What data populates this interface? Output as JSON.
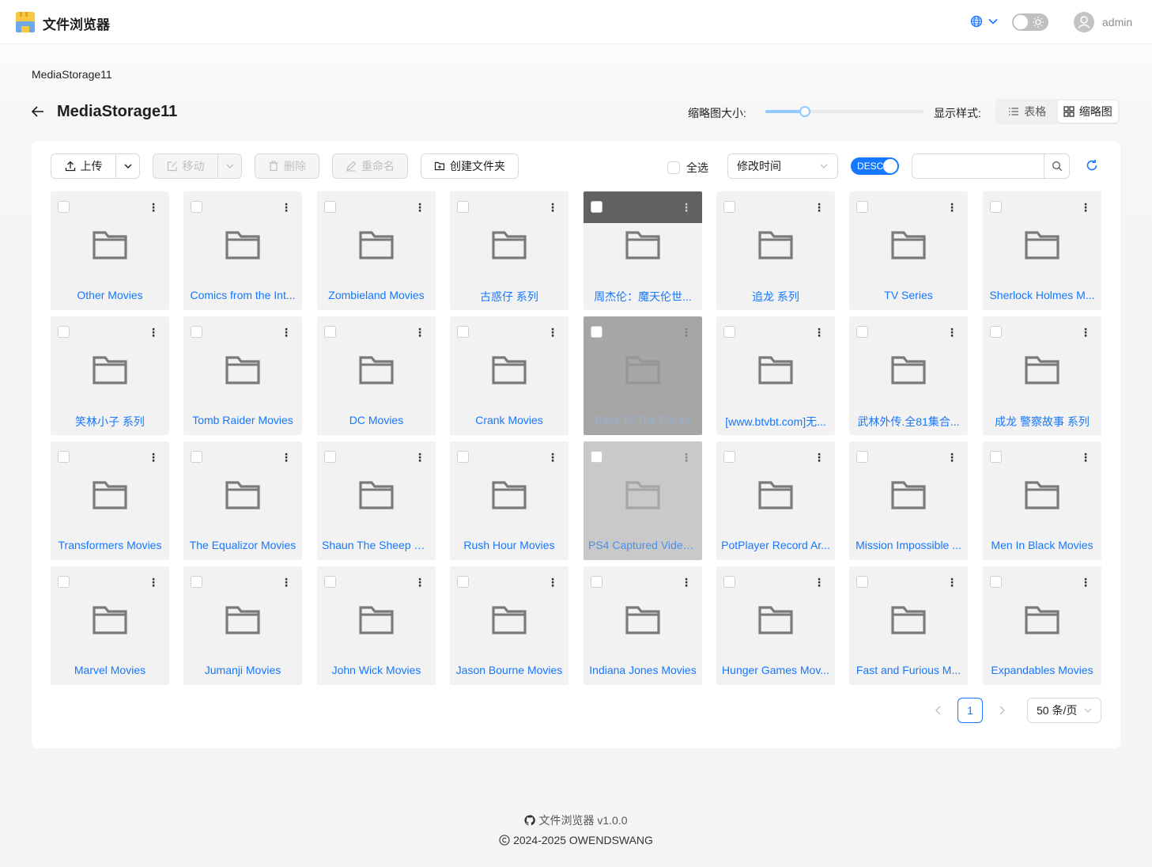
{
  "header": {
    "app_title": "文件浏览器",
    "username": "admin",
    "theme": "light"
  },
  "breadcrumb": "MediaStorage11",
  "page_title": "MediaStorage11",
  "view_controls": {
    "thumb_size_label": "缩略图大小:",
    "thumb_size_value": 0.25,
    "display_label": "显示样式:",
    "modes": [
      {
        "label": "表格",
        "icon": "list-icon",
        "active": false
      },
      {
        "label": "缩略图",
        "icon": "grid-icon",
        "active": true
      }
    ]
  },
  "toolbar": {
    "upload_label": "上传",
    "move_label": "移动",
    "delete_label": "删除",
    "rename_label": "重命名",
    "create_folder_label": "创建文件夹",
    "select_all_label": "全选",
    "sort_value": "修改时间",
    "order_label": "DESC",
    "search_placeholder": ""
  },
  "items": [
    {
      "name": "Other Movies",
      "state": "normal"
    },
    {
      "name": "Comics from the Int...",
      "state": "normal"
    },
    {
      "name": "Zombieland Movies",
      "state": "normal"
    },
    {
      "name": "古惑仔 系列",
      "state": "normal"
    },
    {
      "name": "周杰伦：魔天伦世...",
      "state": "hover"
    },
    {
      "name": "追龙 系列",
      "state": "normal"
    },
    {
      "name": "TV Series",
      "state": "normal"
    },
    {
      "name": "Sherlock Holmes M...",
      "state": "normal"
    },
    {
      "name": "笑林小子 系列",
      "state": "normal"
    },
    {
      "name": "Tomb Raider Movies",
      "state": "normal"
    },
    {
      "name": "DC Movies",
      "state": "normal"
    },
    {
      "name": "Crank Movies",
      "state": "normal"
    },
    {
      "name": "Back To The Future",
      "state": "dim1"
    },
    {
      "name": "[www.btvbt.com]无...",
      "state": "normal"
    },
    {
      "name": "武林外传.全81集合...",
      "state": "normal"
    },
    {
      "name": "成龙 警察故事 系列",
      "state": "normal"
    },
    {
      "name": "Transformers Movies",
      "state": "normal"
    },
    {
      "name": "The Equalizor Movies",
      "state": "normal"
    },
    {
      "name": "Shaun The Sheep M...",
      "state": "normal"
    },
    {
      "name": "Rush Hour Movies",
      "state": "normal"
    },
    {
      "name": "PS4 Captured Video...",
      "state": "dim2"
    },
    {
      "name": "PotPlayer Record Ar...",
      "state": "normal"
    },
    {
      "name": "Mission Impossible ...",
      "state": "normal"
    },
    {
      "name": "Men In Black Movies",
      "state": "normal"
    },
    {
      "name": "Marvel Movies",
      "state": "normal"
    },
    {
      "name": "Jumanji Movies",
      "state": "normal"
    },
    {
      "name": "John Wick Movies",
      "state": "normal"
    },
    {
      "name": "Jason Bourne Movies",
      "state": "normal"
    },
    {
      "name": "Indiana Jones Movies",
      "state": "normal"
    },
    {
      "name": "Hunger Games Mov...",
      "state": "normal"
    },
    {
      "name": "Fast and Furious M...",
      "state": "normal"
    },
    {
      "name": "Expandables Movies",
      "state": "normal"
    }
  ],
  "pagination": {
    "current_page": "1",
    "page_size": "50 条/页"
  },
  "footer": {
    "line1": "文件浏览器 v1.0.0",
    "line2": "2024-2025 OWENDSWANG"
  },
  "colors": {
    "accent": "#1677ff",
    "tile_bg": "#f2f2f2",
    "folder_icon": "#7a7a7a"
  }
}
